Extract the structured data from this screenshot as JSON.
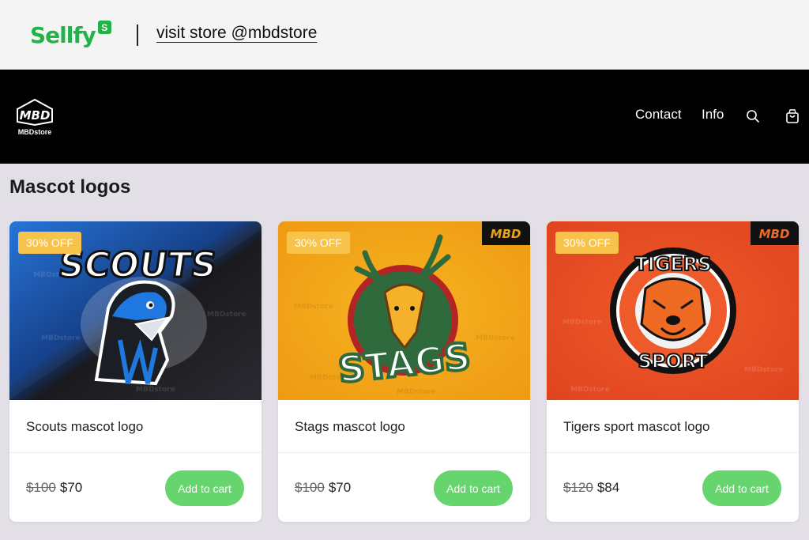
{
  "sellfy_bar": {
    "logo_text": "Sellfy",
    "logo_badge": "S",
    "visit_link": "visit store @mbdstore"
  },
  "store_header": {
    "logo_monogram": "MBD",
    "logo_text": "MBDstore",
    "nav": {
      "contact": "Contact",
      "info": "Info",
      "search_icon": "search-icon",
      "cart_icon": "shopping-bag-icon"
    }
  },
  "section": {
    "title": "Mascot logos"
  },
  "products": [
    {
      "badge": "30% OFF",
      "title": "Scouts mascot logo",
      "old_price": "$100",
      "price": "$70",
      "button": "Add to cart",
      "image_text": "SCOUTS",
      "watermark": "MBDstore"
    },
    {
      "badge": "30% OFF",
      "title": "Stags mascot logo",
      "old_price": "$100",
      "price": "$70",
      "button": "Add to cart",
      "image_text": "STAGS",
      "watermark": "MBDstore",
      "corner_mark": "MBD"
    },
    {
      "badge": "30% OFF",
      "title": "Tigers sport mascot logo",
      "old_price": "$120",
      "price": "$84",
      "button": "Add to cart",
      "image_text_top": "TIGERS",
      "image_text_bottom": "SPORT",
      "watermark": "MBDstore",
      "corner_mark": "MBD"
    }
  ],
  "colors": {
    "sellfy_green": "#21b347",
    "header_bg": "#000000",
    "page_bg": "#e3dfe6",
    "badge_bg": "#f7c34a",
    "button_bg": "#67d56e"
  }
}
